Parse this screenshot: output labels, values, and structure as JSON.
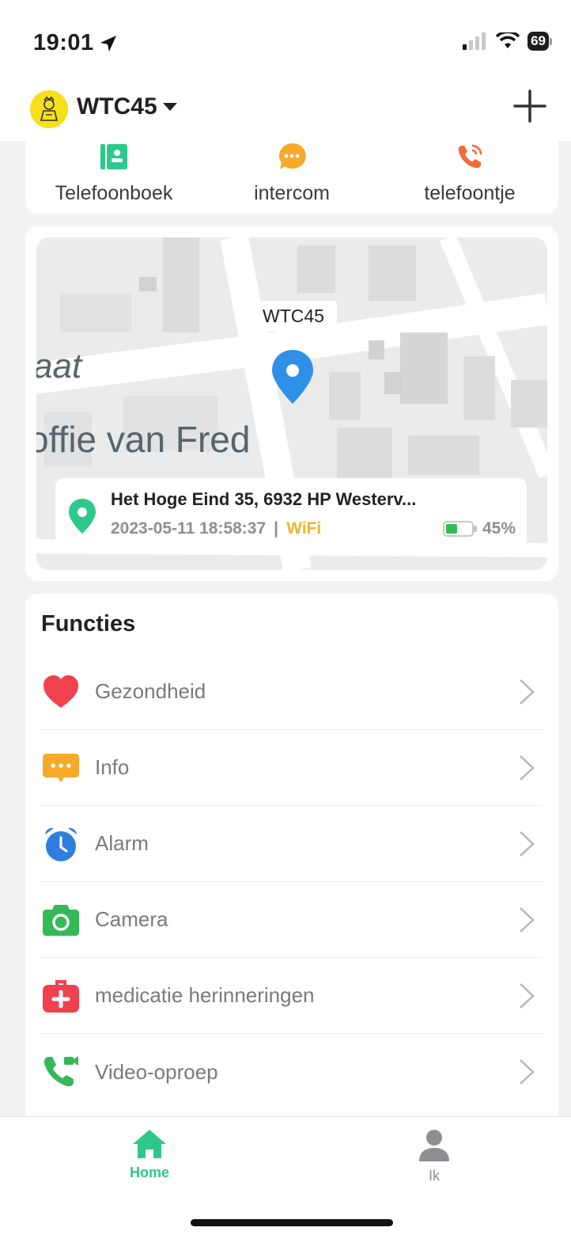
{
  "status_bar": {
    "time": "19:01",
    "battery": "69"
  },
  "header": {
    "device_name": "WTC45"
  },
  "quick_actions": [
    {
      "label": "Telefoonboek",
      "icon": "contact-book-icon",
      "color": "#2ec98a"
    },
    {
      "label": "intercom",
      "icon": "chat-bubble-icon",
      "color": "#f7a928"
    },
    {
      "label": "telefoontje",
      "icon": "phone-call-icon",
      "color": "#f26b3a"
    }
  ],
  "map": {
    "device_label": "WTC45",
    "street_name": "offie van Fred",
    "street_fragment": "aat",
    "address": "Het Hoge Eind 35, 6932 HP Westerv...",
    "timestamp": "2023-05-11 18:58:37",
    "separator": "|",
    "connection": "WiFi",
    "battery_percent": "45%",
    "battery_level": 0.45
  },
  "functions": {
    "title": "Functies",
    "items": [
      {
        "label": "Gezondheid",
        "icon": "heart-icon",
        "color": "#f0414f"
      },
      {
        "label": "Info",
        "icon": "message-icon",
        "color": "#f7a928"
      },
      {
        "label": "Alarm",
        "icon": "alarm-clock-icon",
        "color": "#2f7ddf"
      },
      {
        "label": "Camera",
        "icon": "camera-icon",
        "color": "#33b957"
      },
      {
        "label": "medicatie herinneringen",
        "icon": "medical-kit-icon",
        "color": "#f0414f"
      },
      {
        "label": "Video-oproep",
        "icon": "video-call-icon",
        "color": "#33b957"
      }
    ]
  },
  "tab_bar": {
    "home_label": "Home",
    "me_label": "Ik",
    "active_color": "#2ec98a",
    "inactive_color": "#8e8e93"
  }
}
